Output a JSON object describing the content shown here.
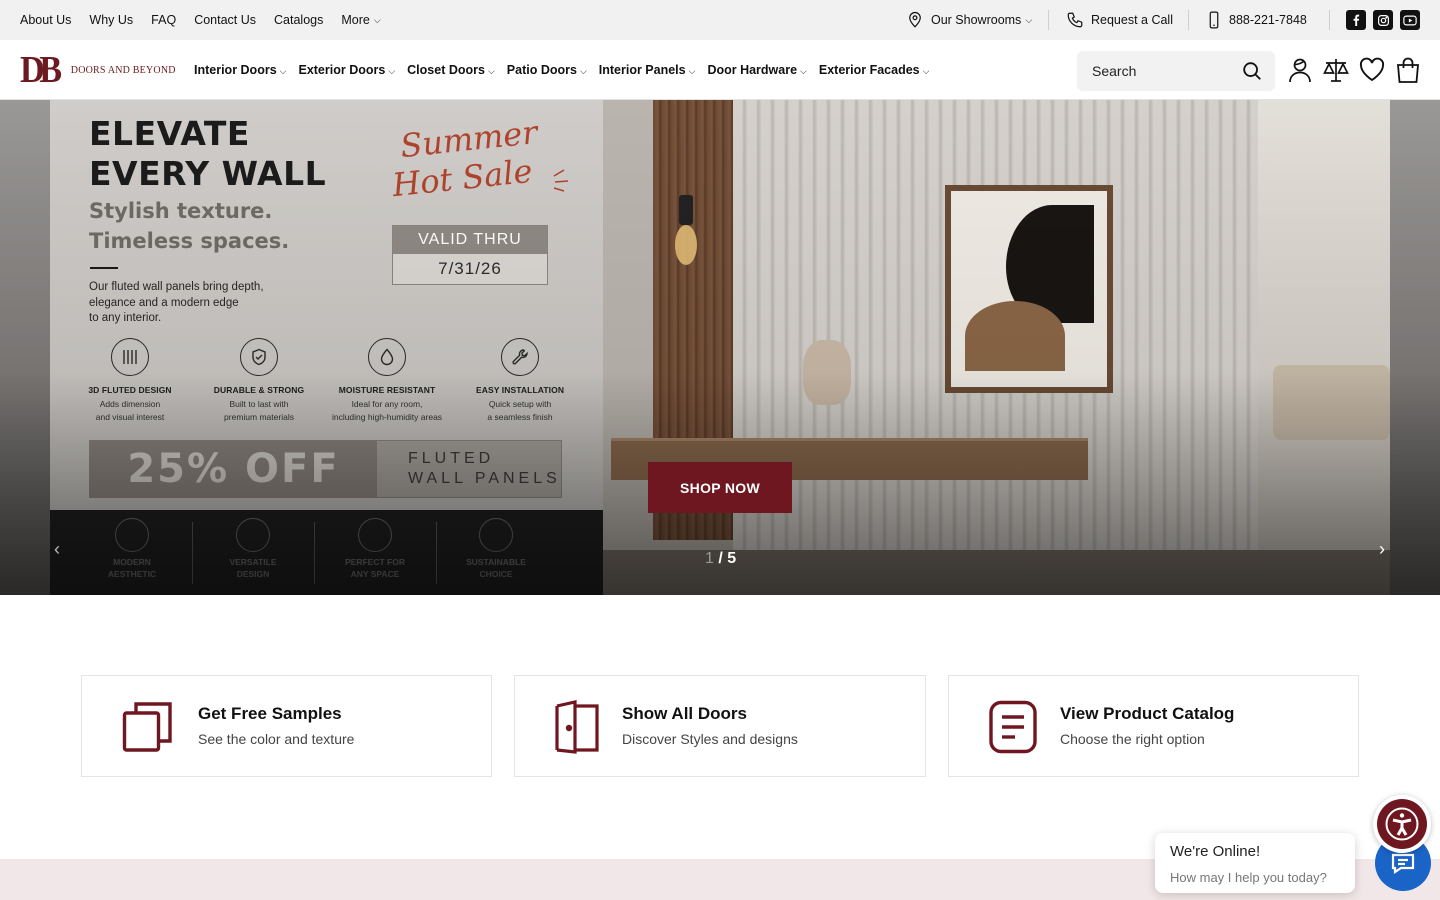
{
  "topbar": {
    "links": [
      "About Us",
      "Why Us",
      "FAQ",
      "Contact Us",
      "Catalogs"
    ],
    "more_label": "More",
    "showrooms_label": "Our Showrooms",
    "request_call_label": "Request a Call",
    "phone": "888-221-7848",
    "socials": [
      "facebook-icon",
      "instagram-icon",
      "youtube-icon"
    ]
  },
  "header": {
    "logo_monogram": "DB",
    "logo_name": "DOORS AND BEYOND",
    "nav": [
      "Interior Doors",
      "Exterior Doors",
      "Closet Doors",
      "Patio Doors",
      "Interior Panels",
      "Door Hardware",
      "Exterior Facades"
    ],
    "search_placeholder": "Search",
    "icons": [
      "user-icon",
      "compare-icon",
      "heart-icon",
      "cart-icon"
    ]
  },
  "hero": {
    "title_line1": "ELEVATE",
    "title_line2": "EVERY WALL",
    "subtitle_line1": "Stylish texture.",
    "subtitle_line2": "Timeless spaces.",
    "body_line1": "Our fluted wall panels bring depth,",
    "body_line2": "elegance and a modern edge",
    "body_line3": "to any interior.",
    "promo_line1": "Summer",
    "promo_line2": "Hot Sale",
    "valid_label": "VALID THRU",
    "valid_date": "7/31/26",
    "features": [
      {
        "title": "3D FLUTED DESIGN",
        "line1": "Adds dimension",
        "line2": "and visual interest"
      },
      {
        "title": "DURABLE & STRONG",
        "line1": "Built to last with",
        "line2": "premium materials"
      },
      {
        "title": "MOISTURE RESISTANT",
        "line1": "Ideal for any room,",
        "line2": "including high-humidity areas"
      },
      {
        "title": "EASY INSTALLATION",
        "line1": "Quick setup with",
        "line2": "a seamless finish"
      }
    ],
    "discount": "25% OFF",
    "discount_item_line1": "FLUTED",
    "discount_item_line2": "WALL PANELS",
    "bottom_items": [
      {
        "line1": "MODERN",
        "line2": "AESTHETIC"
      },
      {
        "line1": "VERSATILE",
        "line2": "DESIGN"
      },
      {
        "line1": "PERFECT FOR",
        "line2": "ANY SPACE"
      },
      {
        "line1": "SUSTAINABLE",
        "line2": "CHOICE"
      }
    ],
    "cta_label": "SHOP NOW",
    "slide_current": "1",
    "slide_total": "/ 5",
    "prev_arrow": "‹",
    "next_arrow": "›"
  },
  "cards": [
    {
      "title": "Get Free Samples",
      "subtitle": "See the color and texture",
      "icon": "samples-icon"
    },
    {
      "title": "Show All Doors",
      "subtitle": "Discover Styles and designs",
      "icon": "door-icon"
    },
    {
      "title": "View Product Catalog",
      "subtitle": "Choose the right option",
      "icon": "catalog-icon"
    }
  ],
  "chat": {
    "title": "We're Online!",
    "message": "How may I help you today?"
  },
  "colors": {
    "brand": "#6e1720",
    "chat_blue": "#1a63c7",
    "topbar_bg": "#f1f1f1",
    "band_pink": "#f2e7e8"
  }
}
